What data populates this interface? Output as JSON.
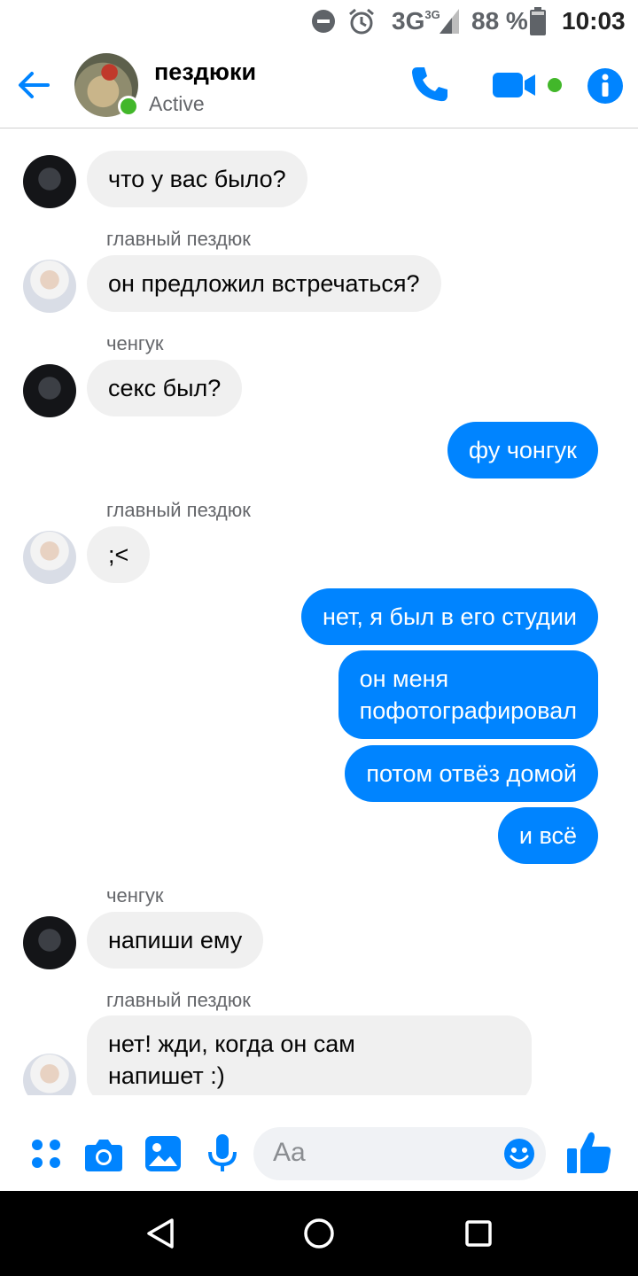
{
  "status_bar": {
    "network": "3G",
    "network_sup": "3G",
    "battery": "88 %",
    "time": "10:03"
  },
  "header": {
    "title": "пездюки",
    "status": "Active"
  },
  "messages": [
    {
      "side": "in",
      "text": "что у вас было?"
    },
    {
      "sender": "главный пездюк"
    },
    {
      "side": "in",
      "text": "он предложил встречаться?"
    },
    {
      "sender": "ченгук"
    },
    {
      "side": "in",
      "text": "секс был?"
    },
    {
      "side": "out",
      "text": "фу чонгук"
    },
    {
      "sender": "главный пездюк"
    },
    {
      "side": "in",
      "text": ";<"
    },
    {
      "side": "out",
      "text": "нет, я был в его студии"
    },
    {
      "side": "out",
      "lines": [
        "он меня",
        "пофотографировал"
      ]
    },
    {
      "side": "out",
      "text": "потом отвёз домой"
    },
    {
      "side": "out",
      "text": "и всё"
    },
    {
      "sender": "ченгук"
    },
    {
      "side": "in",
      "text": "напиши ему"
    },
    {
      "sender": "главный пездюк"
    },
    {
      "side": "in",
      "lines": [
        "нет! жди, когда он сам",
        "напишет :)"
      ]
    }
  ],
  "composer": {
    "placeholder": "Aa"
  },
  "colors": {
    "accent": "#0084ff",
    "online": "#42b72a",
    "incoming_bubble": "#f0f0f0"
  }
}
